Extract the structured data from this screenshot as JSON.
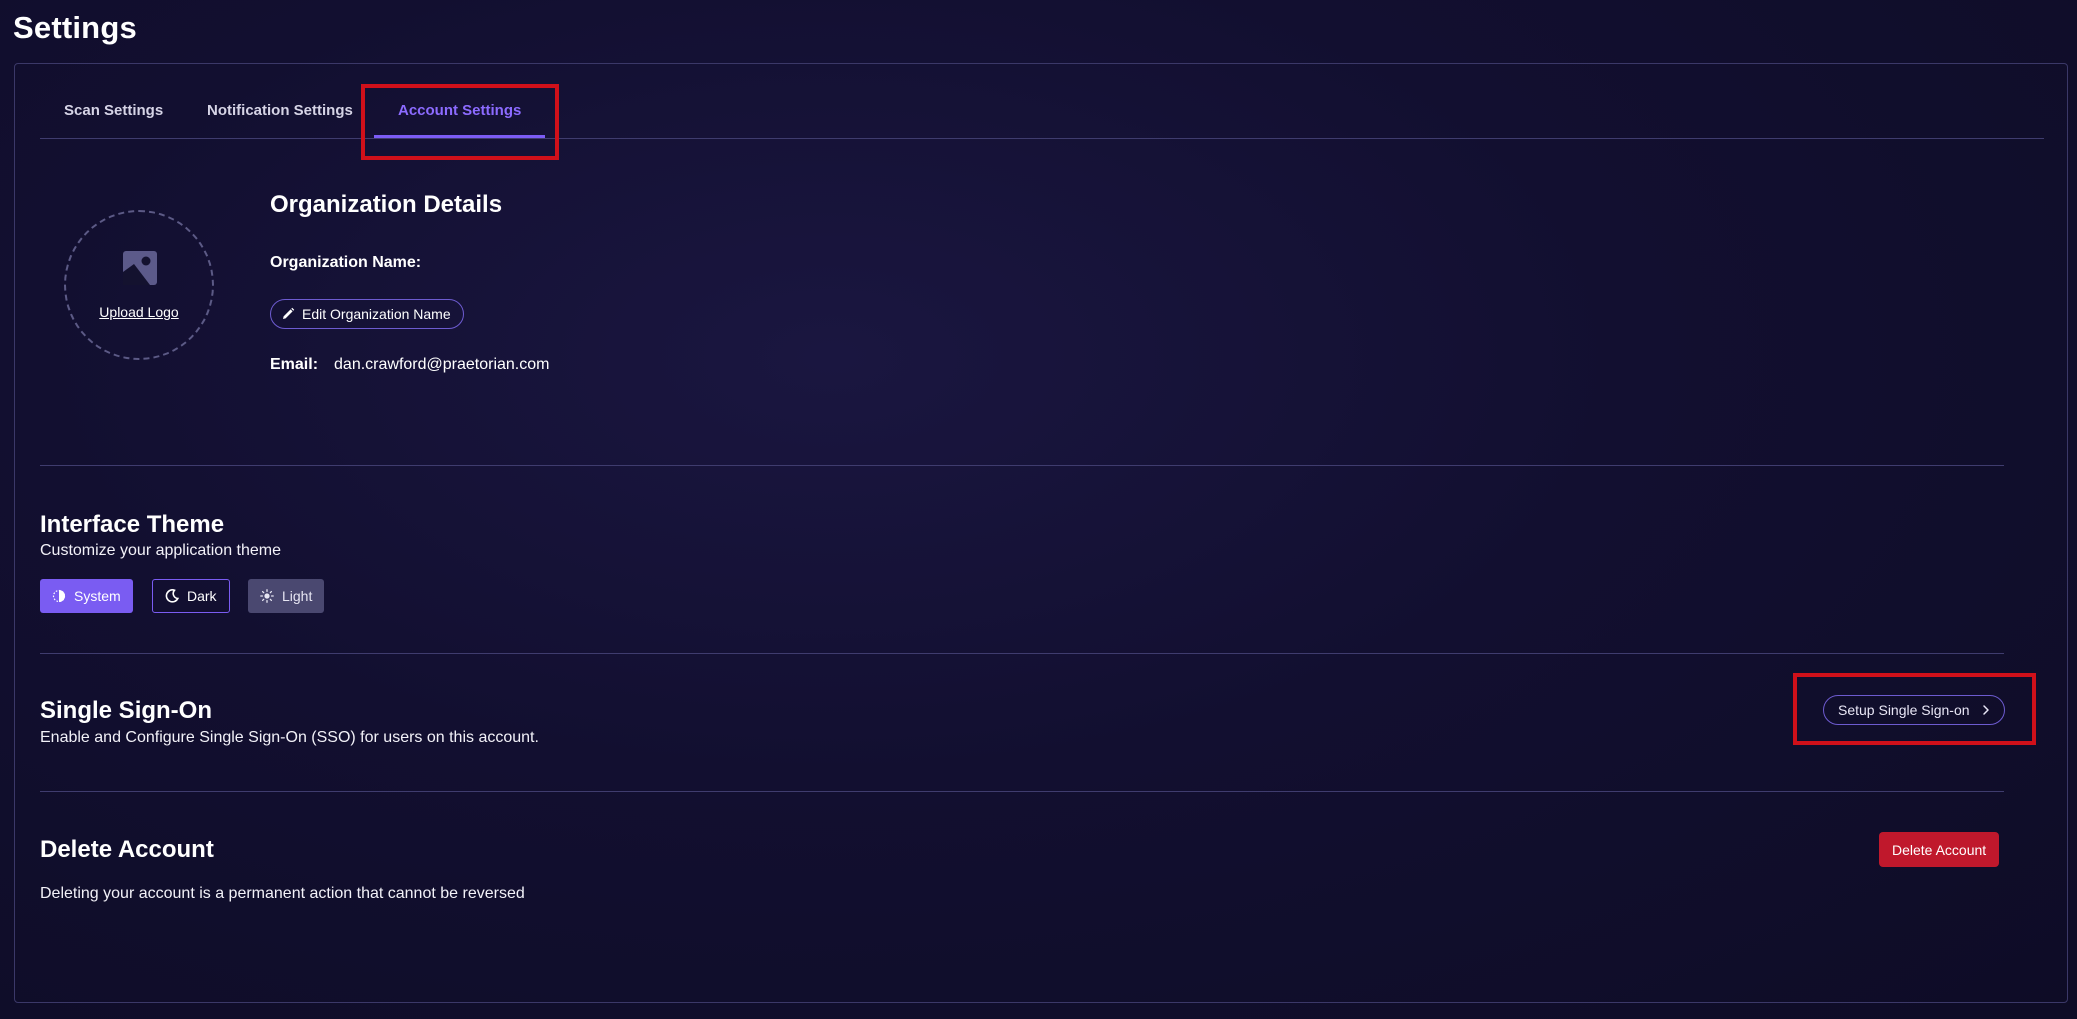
{
  "page": {
    "title": "Settings"
  },
  "tabs": [
    {
      "label": "Scan Settings"
    },
    {
      "label": "Notification Settings"
    },
    {
      "label": "Account Settings",
      "active": true
    }
  ],
  "organization": {
    "upload_logo_label": "Upload Logo",
    "title": "Organization Details",
    "name_label": "Organization Name:",
    "name_value": "",
    "edit_button_label": "Edit Organization Name",
    "email_label": "Email:",
    "email_value": "dan.crawford@praetorian.com"
  },
  "theme": {
    "title": "Interface Theme",
    "description": "Customize your application theme",
    "options": [
      {
        "label": "System",
        "icon": "half-circle-icon",
        "selected": true
      },
      {
        "label": "Dark",
        "icon": "moon-icon",
        "selected": false
      },
      {
        "label": "Light",
        "icon": "sun-icon",
        "selected": false
      }
    ]
  },
  "sso": {
    "title": "Single Sign-On",
    "description": "Enable and Configure Single Sign-On (SSO) for users on this account.",
    "button_label": "Setup Single Sign-on"
  },
  "delete_account": {
    "title": "Delete Account",
    "description": "Deleting your account is a permanent action that cannot be reversed",
    "button_label": "Delete Account"
  },
  "colors": {
    "background": "#100e2a",
    "accent": "#7c5cf5",
    "danger": "#c0182c",
    "highlight": "#d0101a"
  }
}
